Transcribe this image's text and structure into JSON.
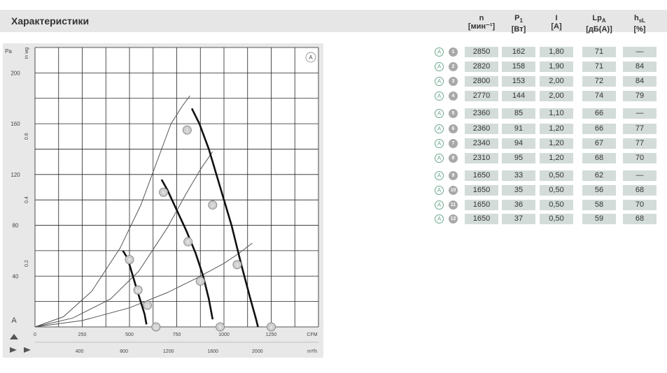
{
  "header": {
    "title": "Характеристики"
  },
  "table": {
    "columns": [
      {
        "name": "n",
        "unit": "[мин⁻¹]"
      },
      {
        "name": "P",
        "sub": "1",
        "unit": "[Вт]"
      },
      {
        "name": "I",
        "unit": "[A]"
      },
      {
        "name": "Lp",
        "sub": "A",
        "unit": "[дБ(A)]"
      },
      {
        "name": "h",
        "sub": "sL",
        "unit": "[%]"
      }
    ],
    "rows": [
      {
        "mark": "A",
        "num": "1",
        "values": [
          "2850",
          "162",
          "1,80",
          "71",
          "—"
        ]
      },
      {
        "mark": "A",
        "num": "2",
        "values": [
          "2820",
          "158",
          "1,90",
          "71",
          "84"
        ]
      },
      {
        "mark": "A",
        "num": "3",
        "values": [
          "2800",
          "153",
          "2,00",
          "72",
          "84"
        ]
      },
      {
        "mark": "A",
        "num": "4",
        "values": [
          "2770",
          "144",
          "2,00",
          "74",
          "79"
        ]
      },
      {
        "mark": "A",
        "num": "5",
        "values": [
          "2360",
          "85",
          "1,10",
          "66",
          "—"
        ]
      },
      {
        "mark": "A",
        "num": "6",
        "values": [
          "2360",
          "91",
          "1,20",
          "66",
          "77"
        ]
      },
      {
        "mark": "A",
        "num": "7",
        "values": [
          "2340",
          "94",
          "1,20",
          "67",
          "77"
        ]
      },
      {
        "mark": "A",
        "num": "8",
        "values": [
          "2310",
          "95",
          "1,20",
          "68",
          "70"
        ]
      },
      {
        "mark": "A",
        "num": "9",
        "values": [
          "1650",
          "33",
          "0,50",
          "62",
          "—"
        ]
      },
      {
        "mark": "A",
        "num": "10",
        "values": [
          "1650",
          "35",
          "0,50",
          "56",
          "68"
        ]
      },
      {
        "mark": "A",
        "num": "11",
        "values": [
          "1650",
          "36",
          "0,50",
          "58",
          "70"
        ]
      },
      {
        "mark": "A",
        "num": "12",
        "values": [
          "1650",
          "37",
          "0,50",
          "59",
          "68"
        ]
      }
    ]
  },
  "chart_data": {
    "type": "line",
    "grid": true,
    "corner_mark": "A",
    "y_label_left": "Pa",
    "y_label_left2": "in wg",
    "bottom_mark": "A",
    "xlim": [
      0,
      1500
    ],
    "ylim": [
      0,
      220
    ],
    "x_ticks": [
      {
        "value": 0,
        "label": "0"
      },
      {
        "value": 250,
        "label": "250"
      },
      {
        "value": 500,
        "label": "500"
      },
      {
        "value": 750,
        "label": "750"
      },
      {
        "value": 1000,
        "label": "1000"
      },
      {
        "value": 1250,
        "label": "1250"
      }
    ],
    "x_unit": "CFM",
    "x2_ticks": [
      {
        "value": 400,
        "label": "400"
      },
      {
        "value": 800,
        "label": "800"
      },
      {
        "value": 1200,
        "label": "1200"
      },
      {
        "value": 1600,
        "label": "1600"
      },
      {
        "value": 2000,
        "label": "2000"
      }
    ],
    "x2_unit": "m³/h",
    "x2_scale": 1.699,
    "y_ticks": [
      {
        "value": 40,
        "label": "40"
      },
      {
        "value": 80,
        "label": "80"
      },
      {
        "value": 120,
        "label": "120"
      },
      {
        "value": 160,
        "label": "160"
      },
      {
        "value": 200,
        "label": "200"
      }
    ],
    "y2_ticks": [
      {
        "value": 50,
        "label": "0.2"
      },
      {
        "value": 100,
        "label": "0.4"
      },
      {
        "value": 150,
        "label": "0.6"
      }
    ],
    "series": [
      {
        "x": [
          830,
          870,
          920,
          980,
          1040,
          1090,
          1140,
          1170,
          1180
        ],
        "y": [
          172,
          160,
          140,
          110,
          80,
          50,
          22,
          6,
          0
        ]
      },
      {
        "x": [
          670,
          700,
          750,
          800,
          850,
          890,
          920,
          940
        ],
        "y": [
          116,
          108,
          92,
          76,
          58,
          40,
          22,
          6
        ]
      },
      {
        "x": [
          465,
          490,
          510,
          530,
          555,
          580,
          590
        ],
        "y": [
          60,
          54,
          44,
          34,
          22,
          10,
          2
        ]
      }
    ],
    "curves": [
      {
        "x": [
          0,
          150,
          300,
          450,
          560,
          650,
          720,
          780,
          820
        ],
        "y": [
          0,
          8,
          28,
          62,
          96,
          132,
          160,
          174,
          182
        ]
      },
      {
        "x": [
          0,
          200,
          400,
          550,
          700,
          800,
          880,
          940
        ],
        "y": [
          0,
          7,
          22,
          44,
          78,
          105,
          125,
          138
        ]
      },
      {
        "x": [
          0,
          250,
          500,
          700,
          850,
          1000,
          1080,
          1150
        ],
        "y": [
          0,
          5,
          15,
          27,
          38,
          50,
          58,
          66
        ]
      }
    ],
    "points": [
      {
        "x": 805,
        "y": 155,
        "label": "1"
      },
      {
        "x": 680,
        "y": 106,
        "label": "5"
      },
      {
        "x": 500,
        "y": 53,
        "label": "9"
      },
      {
        "x": 940,
        "y": 96,
        "label": "2"
      },
      {
        "x": 810,
        "y": 67,
        "label": "6"
      },
      {
        "x": 545,
        "y": 29,
        "label": "10"
      },
      {
        "x": 1070,
        "y": 49,
        "label": "3"
      },
      {
        "x": 875,
        "y": 36,
        "label": "7"
      },
      {
        "x": 595,
        "y": 17,
        "label": "11"
      },
      {
        "x": 1250,
        "y": 0,
        "label": "4"
      },
      {
        "x": 980,
        "y": 0,
        "label": "8"
      },
      {
        "x": 640,
        "y": 0,
        "label": "12"
      }
    ],
    "colors": {
      "grid": "#222222",
      "curve": "#555555",
      "point_fill": "#cfcfcf",
      "point_stroke": "#888888",
      "panel": "#e8e8e8"
    }
  }
}
